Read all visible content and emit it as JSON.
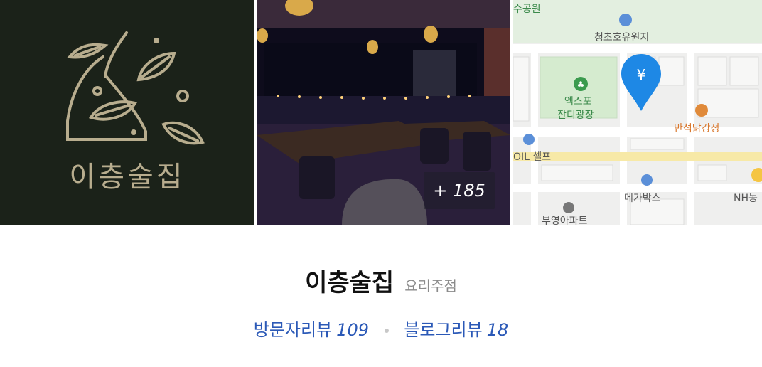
{
  "gallery": {
    "logo_text": "이층술집",
    "more_photos": "+ 185"
  },
  "map": {
    "labels": {
      "park": "수공원",
      "reservoir": "청초호유원지",
      "plaza_1": "엑스포",
      "plaza_2": "잔디광장",
      "restaurant": "만석닭강정",
      "gas": "OIL 셀프",
      "cinema": "메가박스",
      "bank": "NH농",
      "apartment": "부영아파트"
    }
  },
  "place": {
    "name": "이층술집",
    "category": "요리주점",
    "visitor_reviews_label": "방문자리뷰",
    "visitor_reviews_count": "109",
    "blog_reviews_label": "블로그리뷰",
    "blog_reviews_count": "18"
  },
  "colors": {
    "logo_bg": "#1b2219",
    "logo_accent": "#b8ad8e",
    "review_link": "#2b59b7",
    "map_pin": "#1e88e5"
  }
}
